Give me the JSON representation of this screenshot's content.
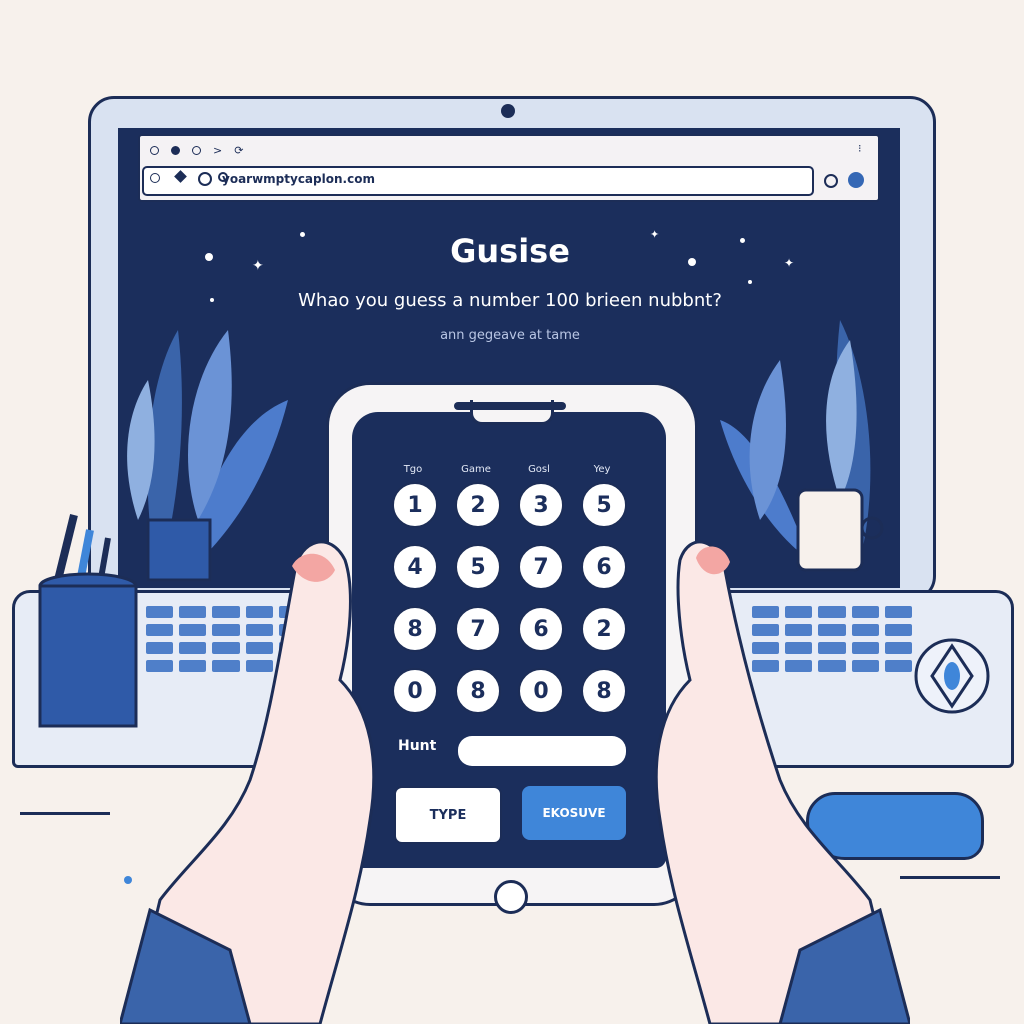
{
  "browser": {
    "url": "yoarwmptycaplon.com"
  },
  "page": {
    "title": "Gusise",
    "question": "Whao you guess a number 100 brieen nubbnt?",
    "subtext": "ann gegeave at tame"
  },
  "keypad": {
    "column_headers": [
      "Tgo",
      "Game",
      "Gosl",
      "Yey"
    ],
    "rows": [
      [
        "1",
        "2",
        "3",
        "5"
      ],
      [
        "4",
        "5",
        "7",
        "6"
      ],
      [
        "8",
        "7",
        "6",
        "2"
      ],
      [
        "0",
        "8",
        "0",
        "8"
      ]
    ]
  },
  "hint": {
    "label": "Hunt",
    "value": ""
  },
  "buttons": {
    "type_label": "TYPE",
    "execute_label": "EKOSUVE"
  },
  "colors": {
    "screen": "#1b2e5c",
    "accent": "#3f86d9",
    "outline": "#1c2d57",
    "background": "#f7f1ec"
  }
}
